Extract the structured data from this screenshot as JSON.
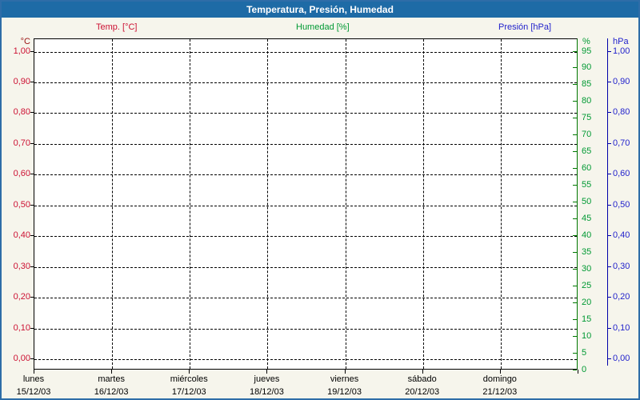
{
  "window": {
    "title": "Temperatura, Presión, Humedad",
    "titlebar_color": "#1e6ba6",
    "border_color": "#2e6da8",
    "background_color": "#f6f5ec"
  },
  "legend": {
    "temp": "Temp. [°C]",
    "humidity": "Humedad [%]",
    "pressure": "Presión [hPa]"
  },
  "chart_data": {
    "type": "line",
    "title": "Temperatura, Presión, Humedad",
    "grid": "dashed, on",
    "plot_background": "#ffffff",
    "series": [
      {
        "name": "Temp. [°C]",
        "axis": "temperature",
        "color": "#cc1133",
        "values": []
      },
      {
        "name": "Humedad [%]",
        "axis": "humidity",
        "color": "#009933",
        "values": []
      },
      {
        "name": "Presión [hPa]",
        "axis": "pressure",
        "color": "#2222cc",
        "values": []
      }
    ],
    "note": "plot area is empty — no data curves drawn",
    "axes": {
      "temperature": {
        "side": "left",
        "unit": "°C",
        "unit_color": "#991111",
        "color": "#cc1133",
        "range": [
          0,
          1
        ],
        "ticks": [
          "1,00",
          "0,90",
          "0,80",
          "0,70",
          "0,60",
          "0,50",
          "0,40",
          "0,30",
          "0,20",
          "0,10",
          "0,00"
        ]
      },
      "humidity": {
        "side": "right-inner",
        "unit": "%",
        "unit_color": "#009933",
        "color": "#009933",
        "line_color": "#007700",
        "range": [
          0,
          95
        ],
        "ticks": [
          "95",
          "90",
          "85",
          "80",
          "75",
          "70",
          "65",
          "60",
          "55",
          "50",
          "45",
          "40",
          "35",
          "30",
          "25",
          "20",
          "15",
          "10",
          "5",
          "0"
        ]
      },
      "pressure": {
        "side": "right-outer",
        "unit": "hPa",
        "unit_color": "#2222cc",
        "color": "#2222cc",
        "line_color": "#0000aa",
        "range": [
          0,
          1
        ],
        "ticks": [
          "1,00",
          "0,90",
          "0,80",
          "0,70",
          "0,60",
          "0,50",
          "0,40",
          "0,30",
          "0,20",
          "0,10",
          "0,00"
        ]
      },
      "x": {
        "side": "bottom",
        "days": [
          {
            "name": "lunes",
            "date": "15/12/03"
          },
          {
            "name": "martes",
            "date": "16/12/03"
          },
          {
            "name": "miércoles",
            "date": "17/12/03"
          },
          {
            "name": "jueves",
            "date": "18/12/03"
          },
          {
            "name": "viernes",
            "date": "19/12/03"
          },
          {
            "name": "sábado",
            "date": "20/12/03"
          },
          {
            "name": "domingo",
            "date": "21/12/03"
          }
        ]
      }
    }
  }
}
